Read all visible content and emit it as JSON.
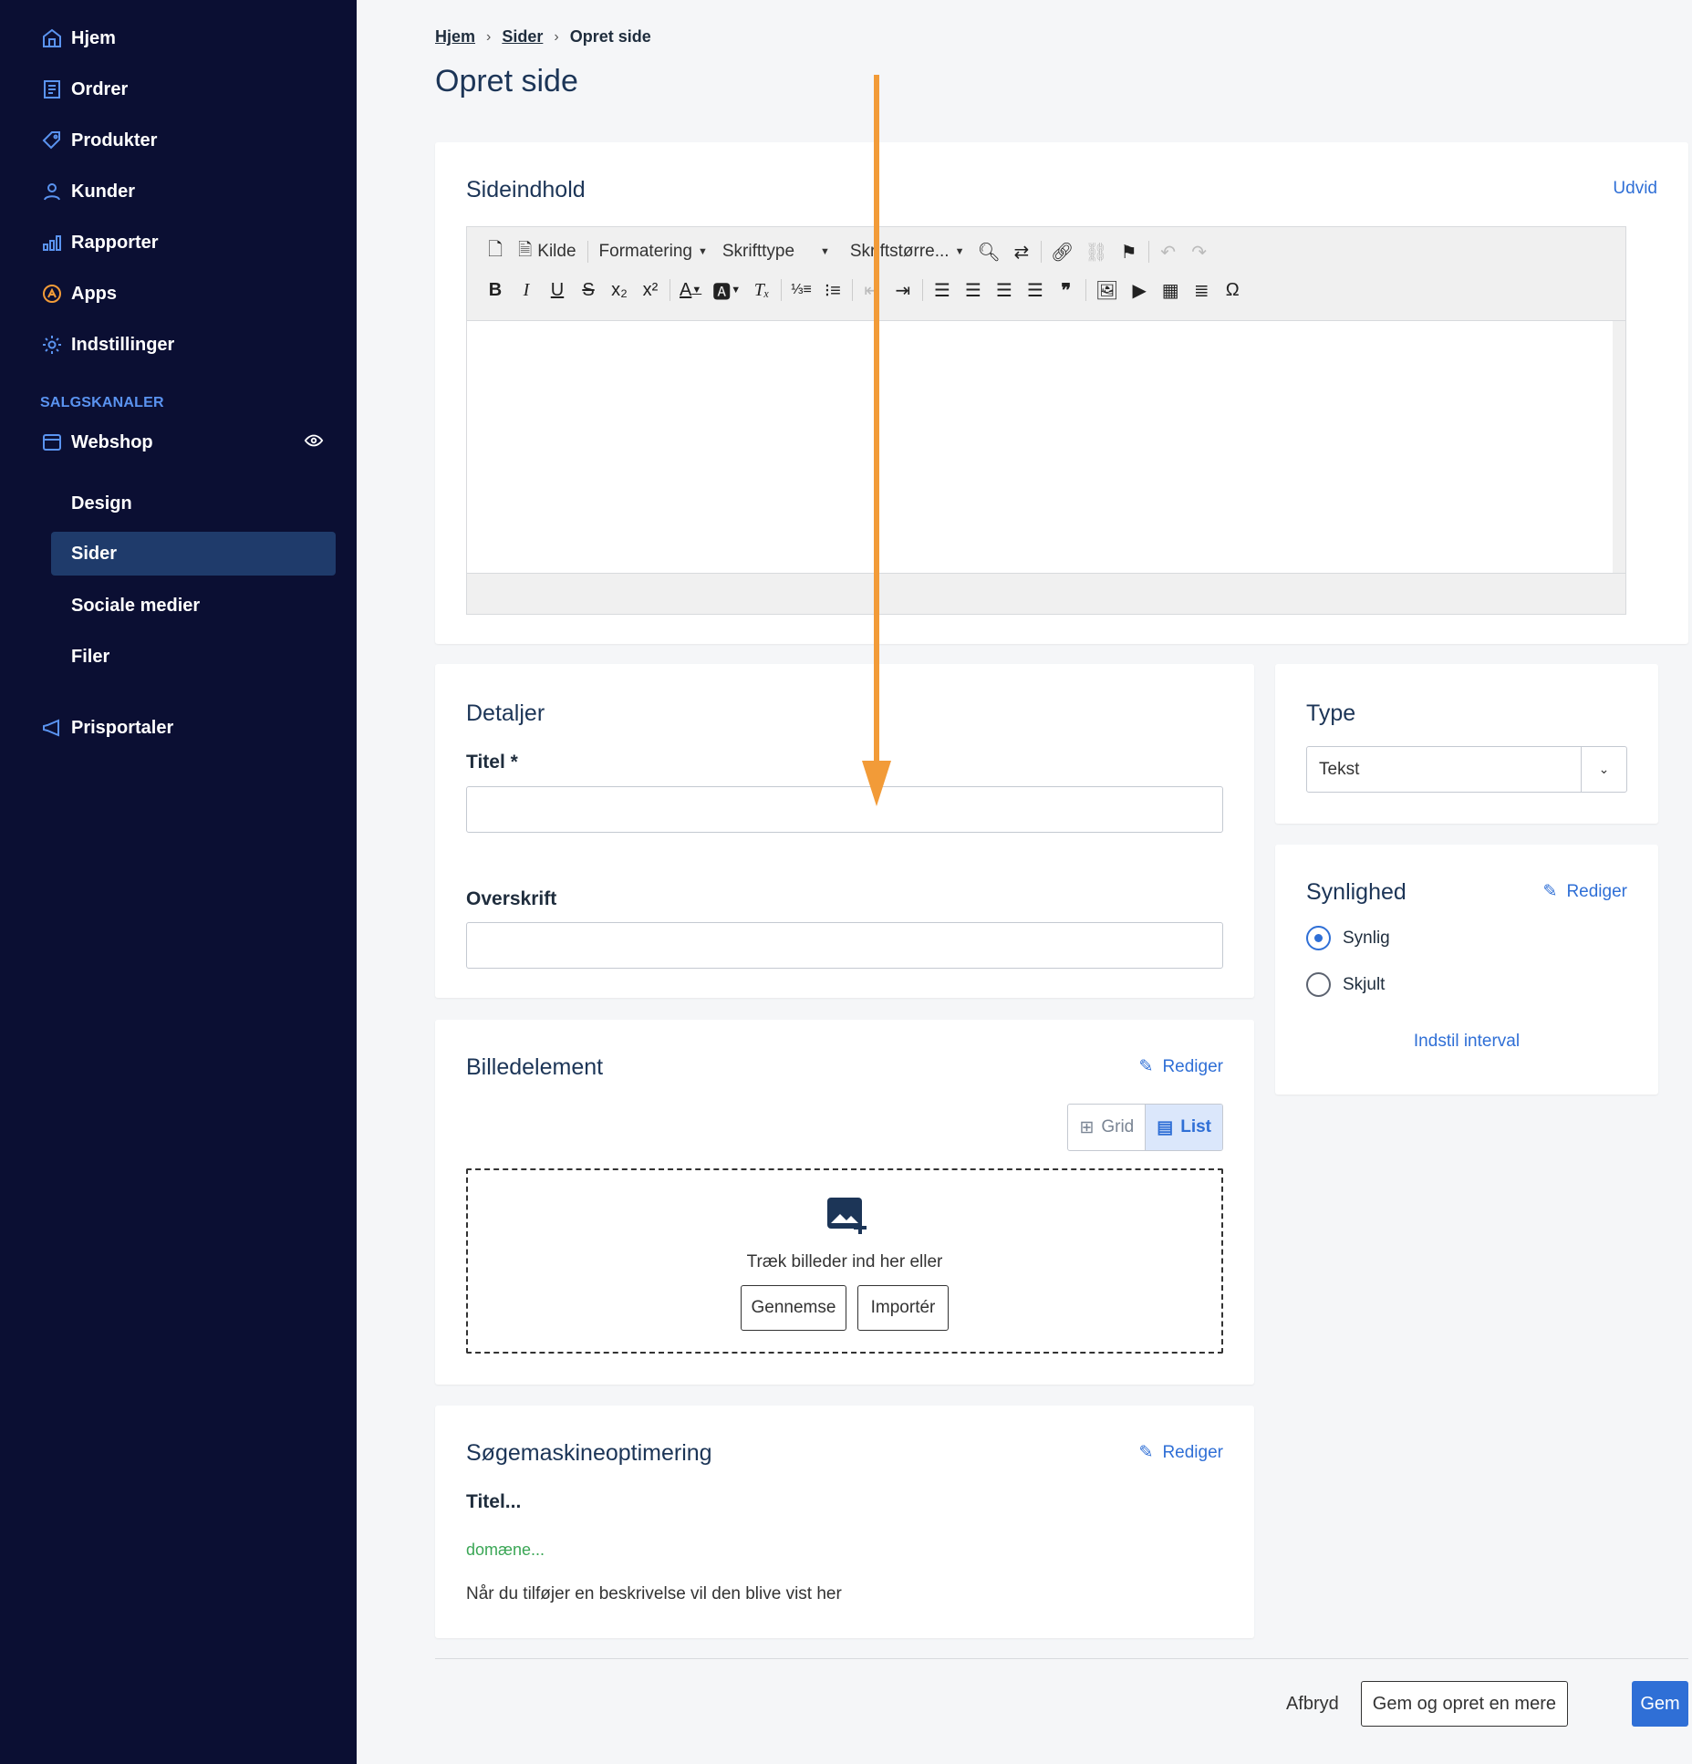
{
  "sidebar": {
    "items": [
      {
        "label": "Hjem",
        "icon": "home-icon"
      },
      {
        "label": "Ordrer",
        "icon": "orders-icon"
      },
      {
        "label": "Produkter",
        "icon": "tag-icon"
      },
      {
        "label": "Kunder",
        "icon": "user-icon"
      },
      {
        "label": "Rapporter",
        "icon": "bar-chart-icon"
      },
      {
        "label": "Apps",
        "icon": "apps-icon"
      },
      {
        "label": "Indstillinger",
        "icon": "gear-icon"
      }
    ],
    "section_label": "SALGSKANALER",
    "channel": {
      "label": "Webshop",
      "icon": "storefront-icon"
    },
    "sub_items": [
      {
        "label": "Design"
      },
      {
        "label": "Sider",
        "active": true
      },
      {
        "label": "Sociale medier"
      },
      {
        "label": "Filer"
      }
    ],
    "bottom_item": {
      "label": "Prisportaler",
      "icon": "megaphone-icon"
    }
  },
  "breadcrumb": {
    "home": "Hjem",
    "pages": "Sider",
    "current": "Opret side"
  },
  "page_title": "Opret side",
  "content_card": {
    "title": "Sideindhold",
    "expand_label": "Udvid",
    "toolbar": {
      "source": "Kilde",
      "format": "Formatering",
      "font": "Skrifttype",
      "size": "Skriftstørre..."
    }
  },
  "details_card": {
    "title": "Detaljer",
    "title_label": "Titel *",
    "heading_label": "Overskrift",
    "title_value": "",
    "heading_value": ""
  },
  "type_card": {
    "title": "Type",
    "selected": "Tekst"
  },
  "visibility_card": {
    "title": "Synlighed",
    "edit_label": "Rediger",
    "options": [
      {
        "label": "Synlig",
        "selected": true
      },
      {
        "label": "Skjult",
        "selected": false
      }
    ],
    "interval_label": "Indstil interval"
  },
  "image_card": {
    "title": "Billedelement",
    "edit_label": "Rediger",
    "view_grid": "Grid",
    "view_list": "List",
    "drop_text": "Træk billeder ind her eller",
    "browse_label": "Gennemse",
    "import_label": "Importér"
  },
  "seo_card": {
    "title": "Søgemaskineoptimering",
    "edit_label": "Rediger",
    "preview_title": "Titel...",
    "preview_domain": "domæne...",
    "preview_description": "Når du tilføjer en beskrivelse vil den blive vist her"
  },
  "footer": {
    "cancel_label": "Afbryd",
    "save_more_label": "Gem og opret en mere",
    "save_label": "Gem"
  },
  "colors": {
    "sidebar_bg": "#0b0f33",
    "accent": "#2f6fd6",
    "annotation_arrow": "#f29b38",
    "seo_domain": "#3aa655"
  }
}
